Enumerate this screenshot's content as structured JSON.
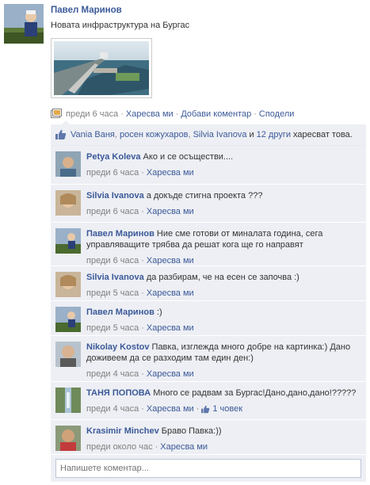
{
  "post": {
    "author": "Павел Маринов",
    "text": "Новата инфраструктура на Бургас",
    "time": "преди 6 часа",
    "actions": [
      "Харесва ми",
      "Добави коментар",
      "Сподели"
    ]
  },
  "likes": {
    "names": [
      "Vania Ваня",
      "росен кожухаров",
      "Silvia Ivanova"
    ],
    "and_word": "и",
    "others": "12 други",
    "suffix": "харесват това."
  },
  "comments": [
    {
      "author": "Petya Koleva",
      "text": "Ако и се осъществи....",
      "time": "преди 6 часа",
      "like": "Харесва ми",
      "like_count": ""
    },
    {
      "author": "Silvia Ivanova",
      "text": "а докъде стигна проекта ???",
      "time": "преди 6 часа",
      "like": "Харесва ми",
      "like_count": ""
    },
    {
      "author": "Павел Маринов",
      "text": "Ние сме готови от миналата година, сега управляващите трябва да решат кога ще го направят",
      "time": "преди 6 часа",
      "like": "Харесва ми",
      "like_count": ""
    },
    {
      "author": "Silvia Ivanova",
      "text": "да разбирам, че на есен се започва :)",
      "time": "преди 5 часа",
      "like": "Харесва ми",
      "like_count": ""
    },
    {
      "author": "Павел Маринов",
      "text": ":)",
      "time": "преди 5 часа",
      "like": "Харесва ми",
      "like_count": ""
    },
    {
      "author": "Nikolay Kostov",
      "text": "Павка, изглежда много добре на картинка:) Дано доживеем да се разходим там един ден:)",
      "time": "преди 4 часа",
      "like": "Харесва ми",
      "like_count": ""
    },
    {
      "author": "ТАНЯ ПОПОВА",
      "text": "Много се радвам за Бургас!Дано,дано,дано!?????",
      "time": "преди 4 часа",
      "like": "Харесва ми",
      "like_count": "1 човек"
    },
    {
      "author": "Krasimir Minchev",
      "text": "Браво Павка:))",
      "time": "преди около час",
      "like": "Харесва ми",
      "like_count": ""
    }
  ],
  "composer": {
    "placeholder": "Напишете коментар..."
  },
  "colors": {
    "link": "#3b5998",
    "feedback_bg": "#edeff4"
  }
}
